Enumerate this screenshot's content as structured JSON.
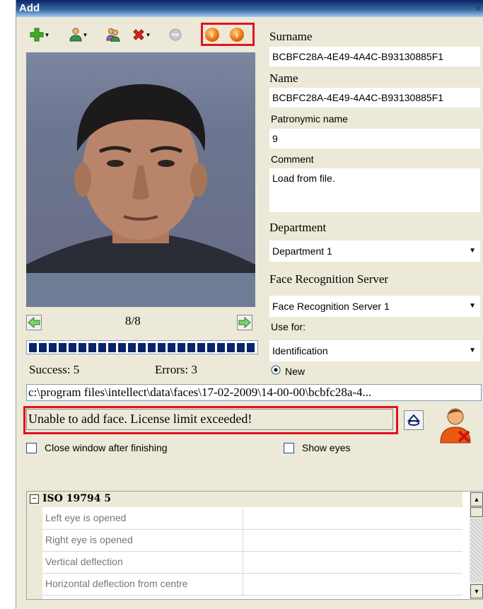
{
  "window": {
    "title": "Add",
    "close_glyph": "×"
  },
  "toolbar": {
    "buttons": [
      {
        "name": "add-button",
        "icon": "plus-green-icon"
      },
      {
        "name": "person-menu-button",
        "icon": "person-icon"
      },
      {
        "name": "persons-button",
        "icon": "persons-icon"
      },
      {
        "name": "delete-button",
        "icon": "red-x-icon"
      },
      {
        "name": "disabled-button",
        "icon": "gray-circle-icon"
      },
      {
        "name": "prev-frame-button",
        "icon": "orange-left-icon"
      },
      {
        "name": "next-frame-button",
        "icon": "orange-right-icon"
      }
    ]
  },
  "photo": {
    "counter": "8/8"
  },
  "progress": {
    "segments": 23
  },
  "stats": {
    "success": "Success: 5",
    "errors": "Errors: 3"
  },
  "form": {
    "surname_label": "Surname",
    "surname_value": "BCBFC28A-4E49-4A4C-B93130885F1",
    "name_label": "Name",
    "name_value": "BCBFC28A-4E49-4A4C-B93130885F1",
    "patronymic_label": "Patronymic name",
    "patronymic_value": "9",
    "comment_label": "Comment",
    "comment_value": "Load from file.",
    "department_label": "Department",
    "department_value": "Department 1",
    "server_label": "Face Recognition Server",
    "server_value": "Face Recognition Server 1",
    "use_for_label": "Use for:",
    "use_for_value": "Identification",
    "new_label": "New"
  },
  "path": "c:\\program files\\intellect\\data\\faces\\17-02-2009\\14-00-00\\bcbfc28a-4...",
  "status_message": "Unable to add face. License limit exceeded!",
  "options": {
    "close_window_label": "Close window after finishing",
    "show_eyes_label": "Show eyes"
  },
  "grid": {
    "group_label": "ISO 19794 5",
    "rows": [
      "Left eye is opened",
      "Right eye is opened",
      "Vertical deflection",
      "Horizontal deflection from centre"
    ]
  },
  "colors": {
    "highlight": "#e0121f",
    "titlebar": "#0a246a",
    "progress": "#0a246a"
  }
}
